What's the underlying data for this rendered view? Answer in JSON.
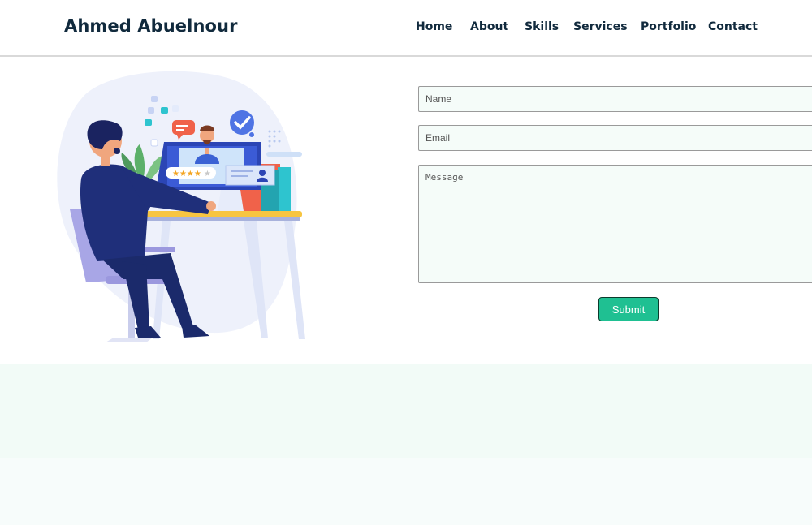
{
  "header": {
    "brand": "Ahmed Abuelnour",
    "nav": [
      {
        "label": "Home"
      },
      {
        "label": "About"
      },
      {
        "label": "Skills"
      },
      {
        "label": "Services"
      },
      {
        "label": "Portfolio"
      },
      {
        "label": "Contact"
      }
    ]
  },
  "illustration": {
    "icon": "customer-support-illustration",
    "rating_stars": 4
  },
  "contact_form": {
    "name_placeholder": "Name",
    "email_placeholder": "Email",
    "message_placeholder": "Message",
    "submit_label": "Submit"
  },
  "colors": {
    "accent": "#1fc092",
    "text": "#112a3d",
    "field_bg": "#f5fcf9",
    "band": "#f2fbf7"
  }
}
